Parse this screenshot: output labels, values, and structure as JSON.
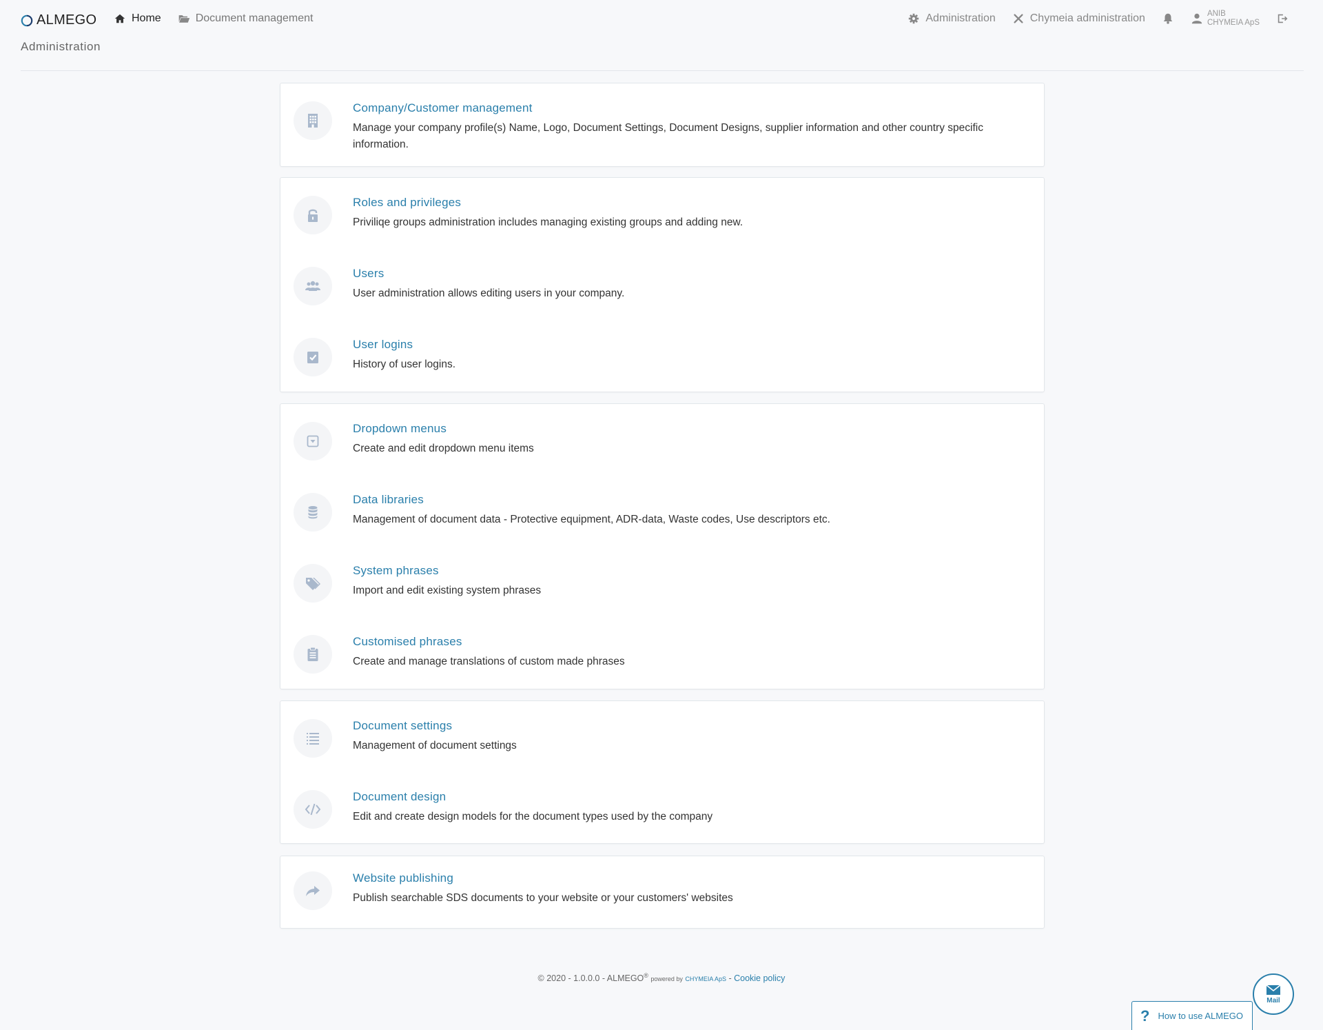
{
  "brand": {
    "name": "ALMEGO"
  },
  "nav": {
    "home": "Home",
    "document_management": "Document management",
    "administration": "Administration",
    "chymeia_administration": "Chymeia administration",
    "user_name": "ANIB",
    "user_company": "CHYMEIA ApS"
  },
  "page": {
    "title": "Administration"
  },
  "cards": [
    {
      "items": [
        {
          "icon": "building-icon",
          "title": "Company/Customer management",
          "description": "Manage your company profile(s) Name, Logo, Document Settings, Document Designs, supplier information and other country specific information."
        }
      ]
    },
    {
      "items": [
        {
          "icon": "lock-icon",
          "title": "Roles and privileges",
          "description": "Priviliqe groups administration includes managing existing groups and adding new."
        },
        {
          "icon": "users-icon",
          "title": "Users",
          "description": "User administration allows editing users in your company."
        },
        {
          "icon": "check-square-icon",
          "title": "User logins",
          "description": "History of user logins."
        }
      ]
    },
    {
      "items": [
        {
          "icon": "dropdown-icon",
          "title": "Dropdown menus",
          "description": "Create and edit dropdown menu items"
        },
        {
          "icon": "database-icon",
          "title": "Data libraries",
          "description": "Management of document data - Protective equipment, ADR-data, Waste codes, Use descriptors etc."
        },
        {
          "icon": "tags-icon",
          "title": "System phrases",
          "description": "Import and edit existing system phrases"
        },
        {
          "icon": "clipboard-icon",
          "title": "Customised phrases",
          "description": "Create and manage translations of custom made phrases"
        }
      ]
    },
    {
      "items": [
        {
          "icon": "list-icon",
          "title": "Document settings",
          "description": "Management of document settings"
        },
        {
          "icon": "code-icon",
          "title": "Document design",
          "description": "Edit and create design models for the document types used by the company"
        }
      ]
    },
    {
      "items": [
        {
          "icon": "share-arrow-icon",
          "title": "Website publishing",
          "description": "Publish searchable SDS documents to your website or your customers' websites"
        }
      ]
    }
  ],
  "footer": {
    "copyright": "© 2020 - 1.0.0.0 - ALMEGO",
    "registered": "®",
    "powered_by": "powered by",
    "company": "CHYMEIA ApS",
    "separator": "-",
    "cookie_policy": "Cookie policy"
  },
  "widgets": {
    "mail_label": "Mail",
    "help_question": "?",
    "help_label": "How to use ALMEGO"
  },
  "colors": {
    "accent": "#2a7fab",
    "icon": "#a9b8cc"
  }
}
